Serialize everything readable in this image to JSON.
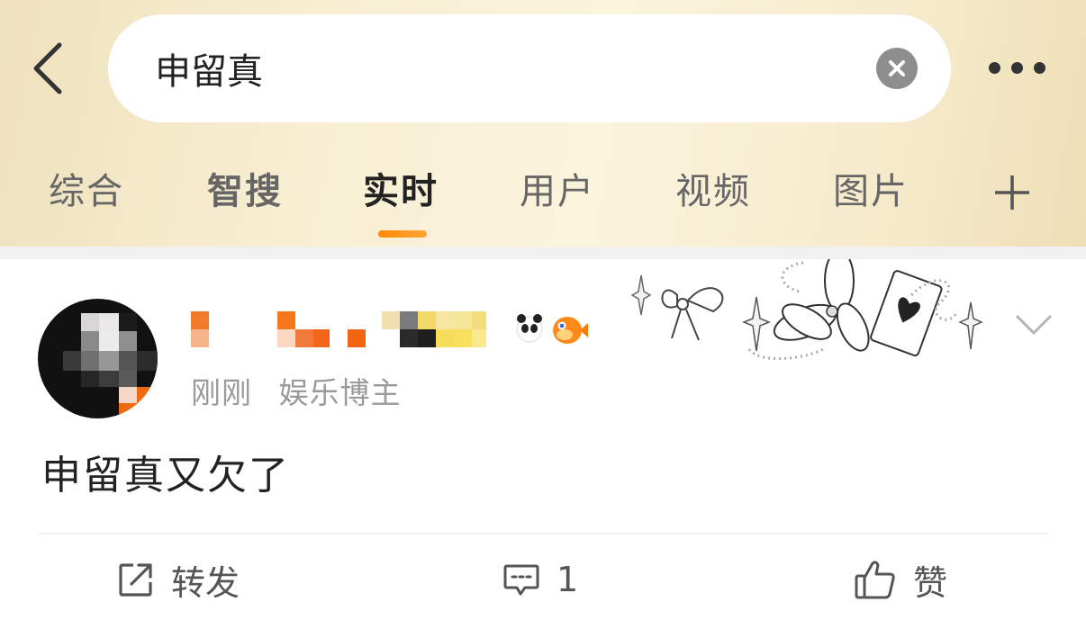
{
  "search": {
    "query": "申留真"
  },
  "tabs": [
    {
      "label": "综合"
    },
    {
      "label": "智搜"
    },
    {
      "label": "实时"
    },
    {
      "label": "用户"
    },
    {
      "label": "视频"
    },
    {
      "label": "图片"
    }
  ],
  "active_tab": "实时",
  "colors": {
    "accent": "#ff8a00",
    "header_bg": "#f6ebcc",
    "text": "#222222",
    "muted": "#9a9a9a"
  },
  "post": {
    "time": "刚刚",
    "source": "娱乐博主",
    "text": "申留真又欠了",
    "actions": {
      "repost_label": "转发",
      "comment_count": "1",
      "like_label": "赞"
    }
  },
  "icons": {
    "back": "chevron-left-icon",
    "clear": "close-circle-icon",
    "more": "more-dots-icon",
    "add_tab": "plus-icon",
    "expand": "chevron-down-icon",
    "repost": "share-icon",
    "comment": "comment-icon",
    "like": "thumbs-up-icon"
  }
}
